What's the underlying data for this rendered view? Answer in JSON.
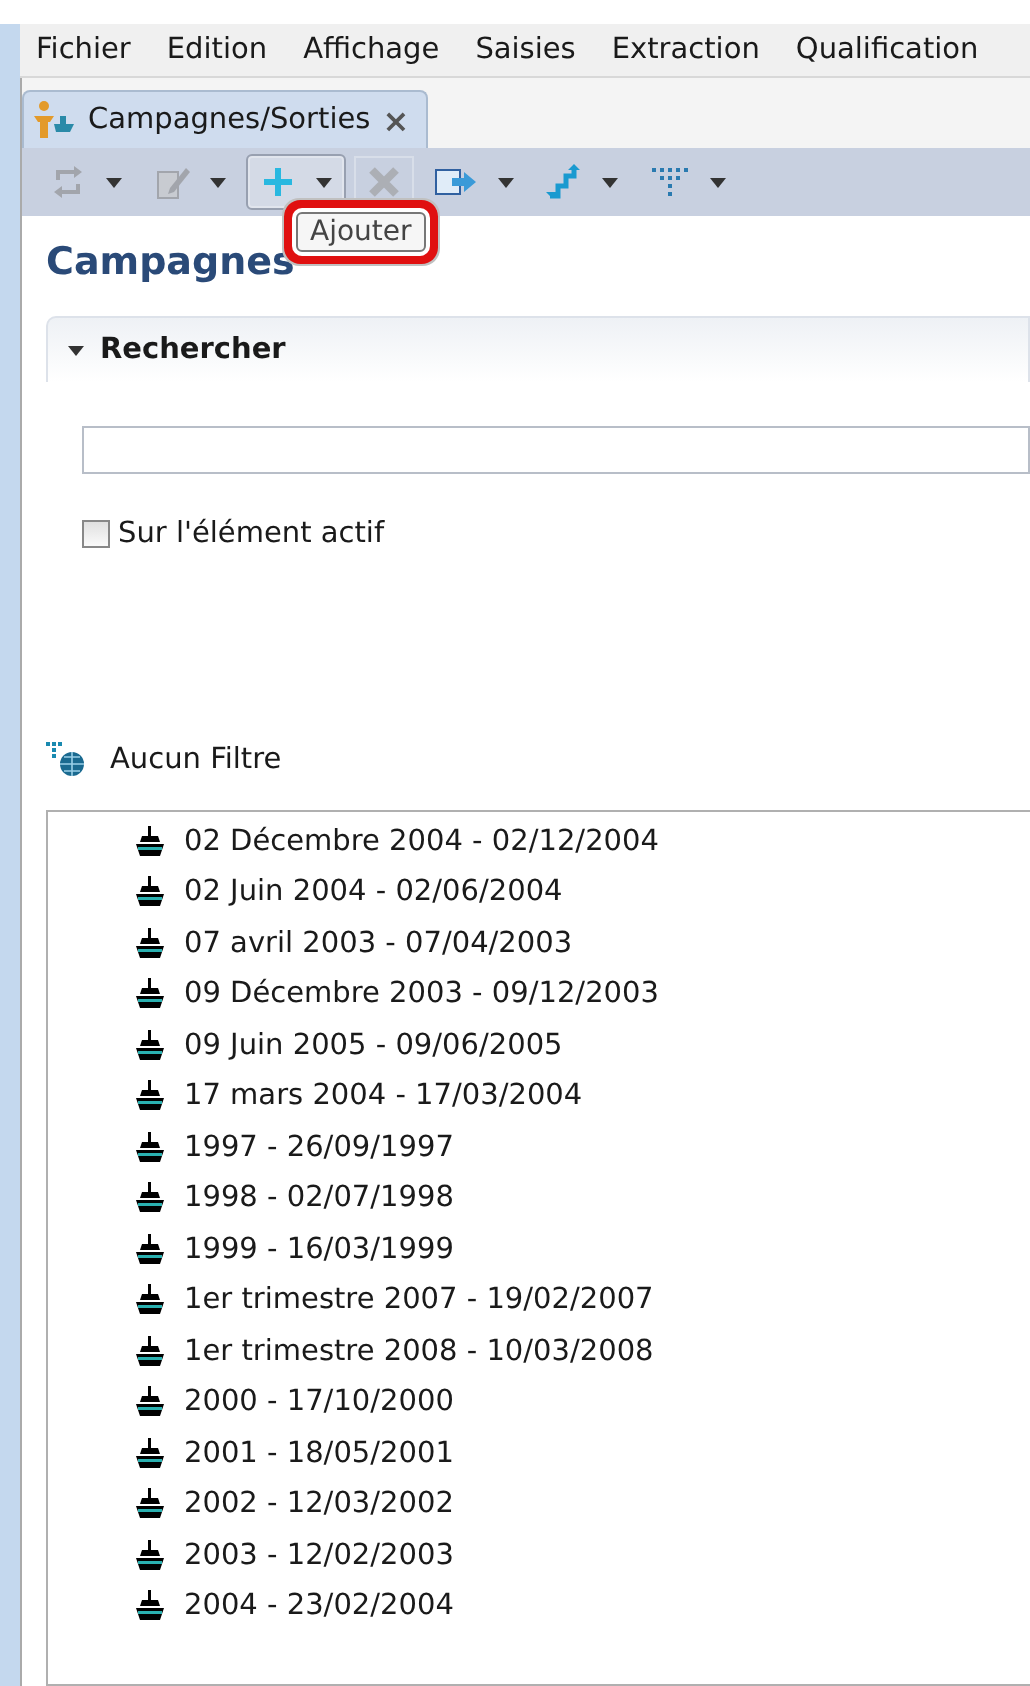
{
  "menu": [
    "Fichier",
    "Edition",
    "Affichage",
    "Saisies",
    "Extraction",
    "Qualification"
  ],
  "tab": {
    "title": "Campagnes/Sorties",
    "selected": true,
    "close": "×"
  },
  "toolbar": [
    {
      "kind": "sync",
      "disabled": true,
      "dropdown": true
    },
    {
      "kind": "edit",
      "disabled": true,
      "dropdown": true
    },
    {
      "kind": "add",
      "disabled": false,
      "dropdown": true,
      "highlighted": true
    },
    {
      "kind": "delete",
      "disabled": true,
      "dropdown": false,
      "highlighted": true
    },
    {
      "kind": "export",
      "disabled": false,
      "dropdown": true
    },
    {
      "kind": "stairs",
      "disabled": false,
      "dropdown": true
    },
    {
      "kind": "filter",
      "disabled": false,
      "dropdown": true
    }
  ],
  "tooltip": "Ajouter",
  "heading": "Campagnes",
  "search_section": {
    "title": "Rechercher",
    "expanded": true,
    "checkbox": {
      "label": "Sur l'élément actif",
      "checked": false
    }
  },
  "filter": {
    "label": "Aucun Filtre"
  },
  "list": [
    "02 Décembre 2004 - 02/12/2004",
    "02 Juin 2004 - 02/06/2004",
    "07 avril 2003 - 07/04/2003",
    "09 Décembre 2003 - 09/12/2003",
    "09 Juin 2005 - 09/06/2005",
    "17 mars 2004 - 17/03/2004",
    "1997 - 26/09/1997",
    "1998 - 02/07/1998",
    "1999 - 16/03/1999",
    "1er trimestre 2007 - 19/02/2007",
    "1er trimestre 2008 - 10/03/2008",
    "2000 - 17/10/2000",
    "2001 - 18/05/2001",
    "2002 - 12/03/2002",
    "2003 - 12/02/2003",
    "2004 - 23/02/2004"
  ]
}
